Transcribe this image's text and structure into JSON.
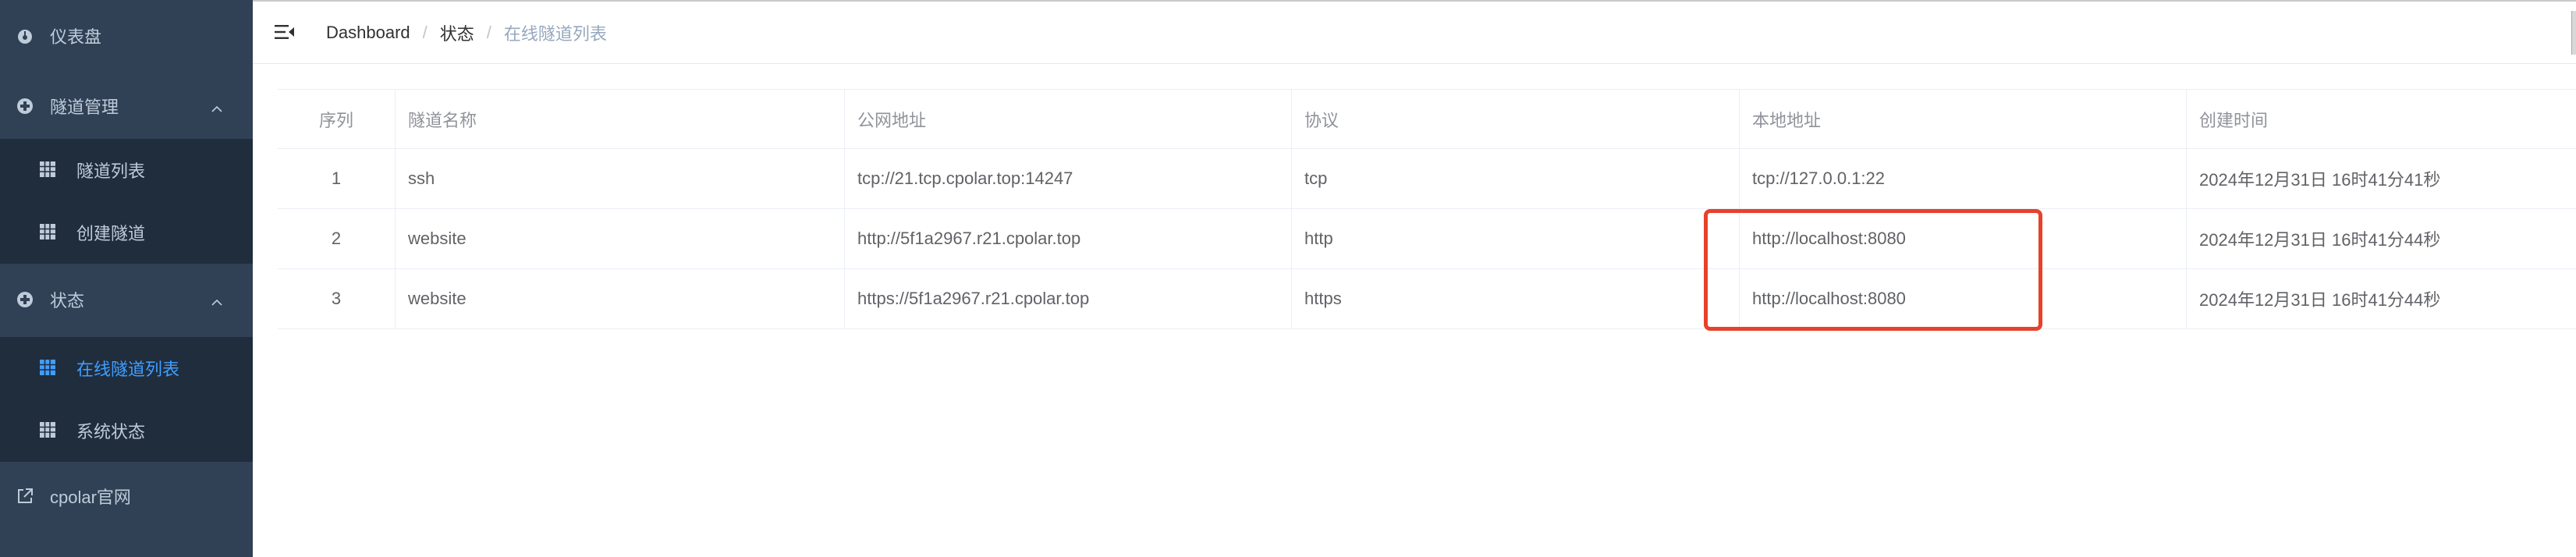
{
  "sidebar": {
    "dashboard": {
      "label": "仪表盘",
      "icon": "dashboard-icon"
    },
    "tunnel_mgmt": {
      "label": "隧道管理",
      "icon": "plus-circle-icon"
    },
    "tunnel_list": {
      "label": "隧道列表",
      "icon": "grid-icon"
    },
    "create_tunnel": {
      "label": "创建隧道",
      "icon": "grid-icon"
    },
    "status": {
      "label": "状态",
      "icon": "plus-circle-icon"
    },
    "online_list": {
      "label": "在线隧道列表",
      "icon": "grid-icon"
    },
    "system_status": {
      "label": "系统状态",
      "icon": "grid-icon"
    },
    "website": {
      "label": "cpolar官网",
      "icon": "external-link-icon"
    }
  },
  "breadcrumb": {
    "home": "Dashboard",
    "section": "状态",
    "current": "在线隧道列表",
    "separator": "/"
  },
  "table": {
    "headers": [
      "序列",
      "隧道名称",
      "公网地址",
      "协议",
      "本地地址",
      "创建时间"
    ],
    "rows": [
      [
        "1",
        "ssh",
        "tcp://21.tcp.cpolar.top:14247",
        "tcp",
        "tcp://127.0.0.1:22",
        "2024年12月31日 16时41分41秒"
      ],
      [
        "2",
        "website",
        "http://5f1a2967.r21.cpolar.top",
        "http",
        "http://localhost:8080",
        "2024年12月31日 16时41分44秒"
      ],
      [
        "3",
        "website",
        "https://5f1a2967.r21.cpolar.top",
        "https",
        "http://localhost:8080",
        "2024年12月31日 16时41分44秒"
      ]
    ]
  },
  "colors": {
    "sidebar_bg": "#304156",
    "submenu_bg": "#1f2d3d",
    "menu_text": "#bfcbd9",
    "active": "#409eff",
    "highlight": "#e8412a"
  }
}
